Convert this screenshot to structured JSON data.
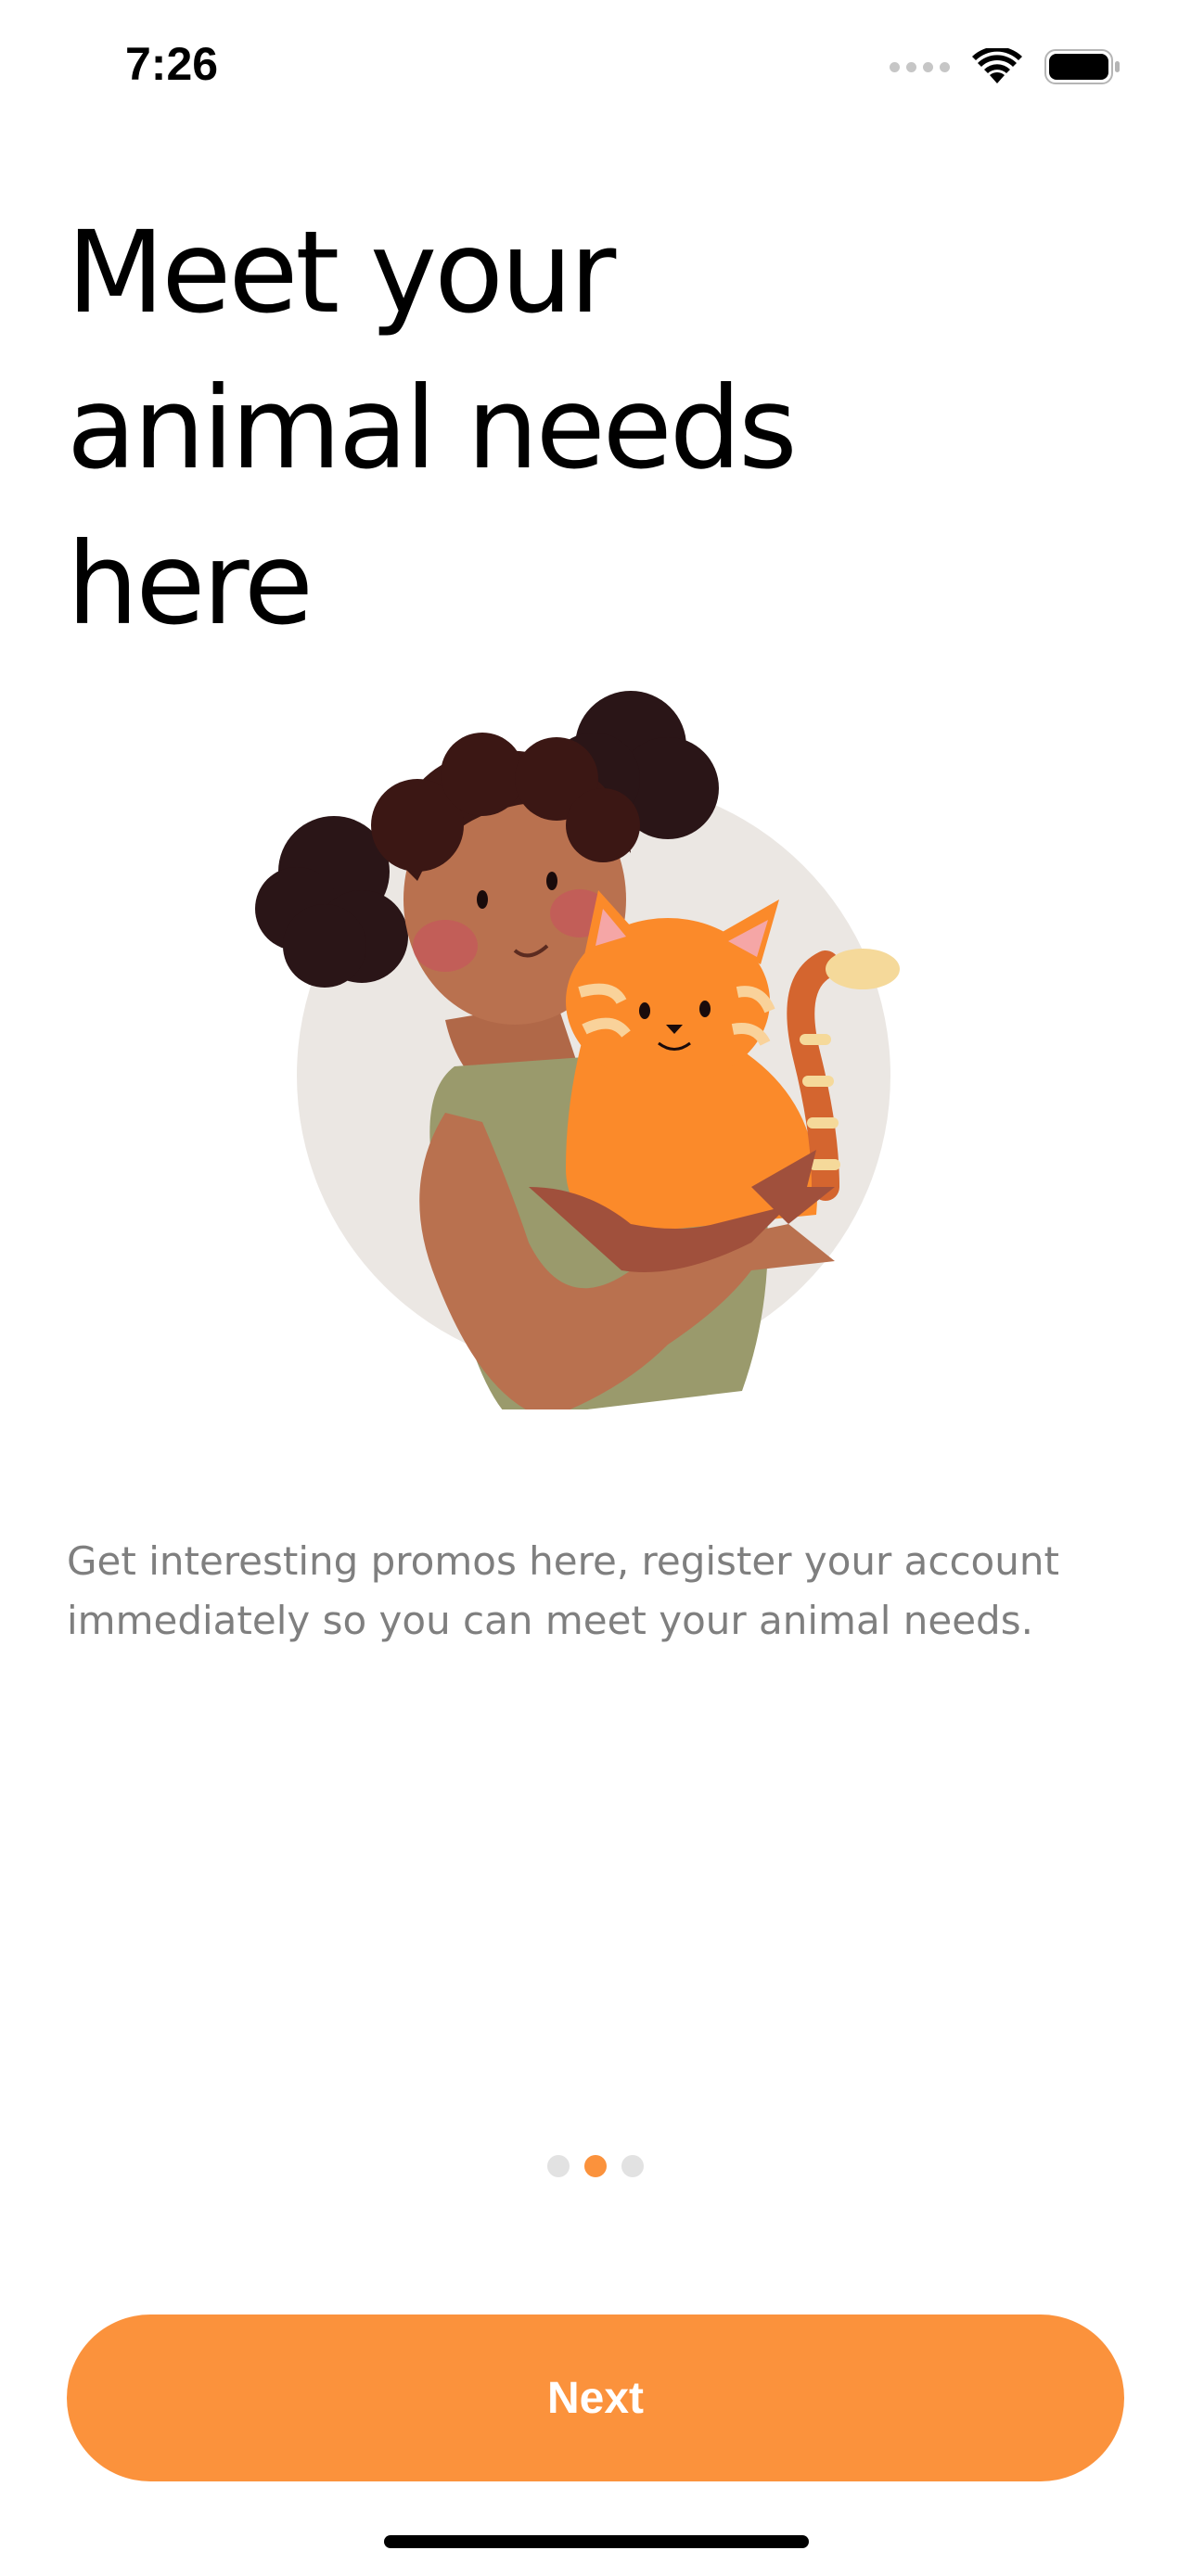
{
  "status_bar": {
    "time": "7:26",
    "icons": [
      "signal-icon",
      "wifi-icon",
      "battery-icon"
    ]
  },
  "onboarding": {
    "title_lines": [
      "Meet your",
      "animal needs",
      "here"
    ],
    "description": "Get interesting promos here, register your account immediately so you can meet your animal needs.",
    "illustration": "woman-holding-cat",
    "pagination": {
      "total": 3,
      "active_index": 1
    },
    "next_label": "Next"
  },
  "colors": {
    "accent": "#fb923c",
    "text_primary": "#000000",
    "text_secondary": "#7f7f7f",
    "dot_inactive": "#e2e2e2"
  }
}
